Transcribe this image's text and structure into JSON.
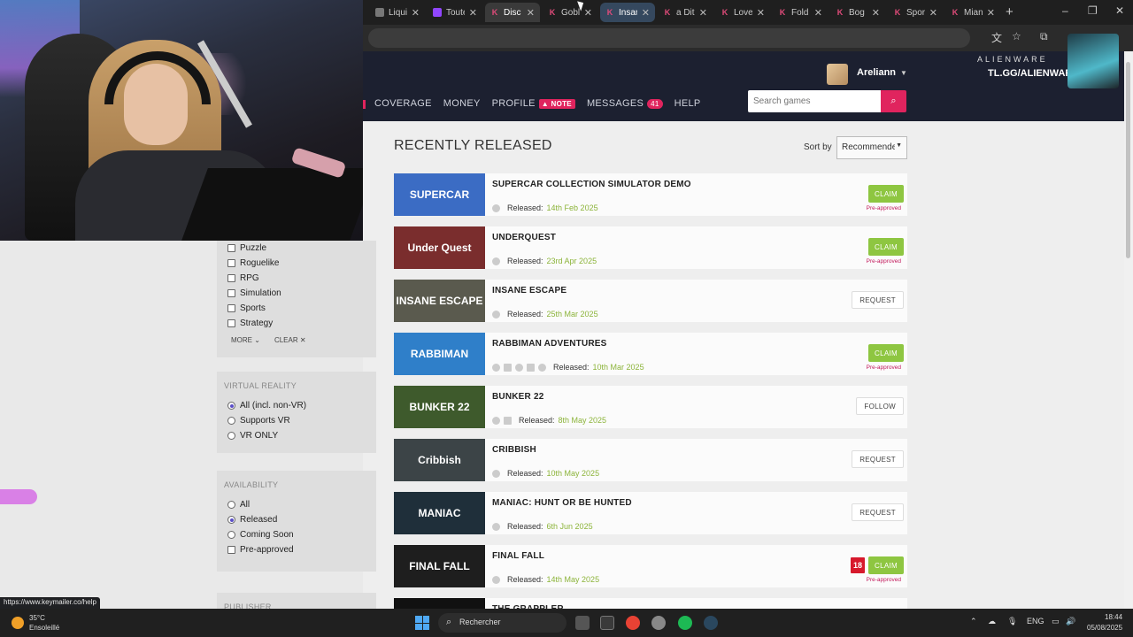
{
  "browser": {
    "tabs": [
      {
        "title": "Liqui",
        "fav": "circle",
        "state": ""
      },
      {
        "title": "Toute",
        "fav": "twitch",
        "state": ""
      },
      {
        "title": "Disc",
        "fav": "k",
        "state": "active"
      },
      {
        "title": "Gobl",
        "fav": "k",
        "state": ""
      },
      {
        "title": "Insan",
        "fav": "k",
        "state": "highlight"
      },
      {
        "title": "a Dit",
        "fav": "k",
        "state": ""
      },
      {
        "title": "Love",
        "fav": "k",
        "state": ""
      },
      {
        "title": "Fold",
        "fav": "k",
        "state": ""
      },
      {
        "title": "Bog",
        "fav": "k",
        "state": ""
      },
      {
        "title": "Spor",
        "fav": "k",
        "state": ""
      },
      {
        "title": "Mian",
        "fav": "k",
        "state": ""
      }
    ],
    "status_url": "https://www.keymailer.co/help"
  },
  "header": {
    "username": "Areliann",
    "nav": {
      "coverage": "COVERAGE",
      "money": "MONEY",
      "profile": "PROFILE",
      "note_badge": "NOTE",
      "messages": "MESSAGES",
      "messages_count": "41",
      "help": "HELP"
    },
    "search_placeholder": "Search games",
    "ad_brand": "ALIENWARE",
    "ad_url": "TL.GG/ALIENWARE"
  },
  "sidebar": {
    "genres": [
      "Puzzle",
      "Roguelike",
      "RPG",
      "Simulation",
      "Sports",
      "Strategy"
    ],
    "more_label": "MORE",
    "clear_label": "CLEAR",
    "vr_title": "VIRTUAL REALITY",
    "vr_options": [
      {
        "label": "All (incl. non-VR)",
        "selected": true
      },
      {
        "label": "Supports VR",
        "selected": false
      },
      {
        "label": "VR ONLY",
        "selected": false
      }
    ],
    "availability_title": "AVAILABILITY",
    "availability_options": [
      {
        "label": "All",
        "type": "radio",
        "selected": false
      },
      {
        "label": "Released",
        "type": "radio",
        "selected": true
      },
      {
        "label": "Coming Soon",
        "type": "radio",
        "selected": false
      },
      {
        "label": "Pre-approved",
        "type": "checkbox",
        "selected": false
      }
    ],
    "publisher_title": "PUBLISHER"
  },
  "main": {
    "title": "RECENTLY RELEASED",
    "sort_label": "Sort by",
    "sort_value": "Recommended",
    "released_label": "Released:",
    "games": [
      {
        "title": "SUPERCAR COLLECTION SIMULATOR DEMO",
        "date": "14th Feb 2025",
        "action": "CLAIM",
        "pre_approved": "Pre-approved",
        "thumb_text": "SUPERCAR",
        "thumb_bg": "#3b6cc4",
        "platforms": 1,
        "pegi": ""
      },
      {
        "title": "UNDERQUEST",
        "date": "23rd Apr 2025",
        "action": "CLAIM",
        "pre_approved": "Pre-approved",
        "thumb_text": "Under Quest",
        "thumb_bg": "#7a2d2d",
        "platforms": 1,
        "pegi": ""
      },
      {
        "title": "INSANE ESCAPE",
        "date": "25th Mar 2025",
        "action": "REQUEST",
        "pre_approved": "",
        "thumb_text": "INSANE ESCAPE",
        "thumb_bg": "#5a5a4e",
        "platforms": 1,
        "pegi": ""
      },
      {
        "title": "RABBIMAN ADVENTURES",
        "date": "10th Mar 2025",
        "action": "CLAIM",
        "pre_approved": "Pre-approved",
        "thumb_text": "RABBIMAN",
        "thumb_bg": "#2f7fc9",
        "platforms": 5,
        "pegi": ""
      },
      {
        "title": "BUNKER 22",
        "date": "8th May 2025",
        "action": "FOLLOW",
        "pre_approved": "",
        "thumb_text": "BUNKER 22",
        "thumb_bg": "#3e5a2c",
        "platforms": 2,
        "pegi": ""
      },
      {
        "title": "CRIBBISH",
        "date": "10th May 2025",
        "action": "REQUEST",
        "pre_approved": "",
        "thumb_text": "Cribbish",
        "thumb_bg": "#3c4447",
        "platforms": 1,
        "pegi": ""
      },
      {
        "title": "MANIAC: HUNT OR BE HUNTED",
        "date": "6th Jun 2025",
        "action": "REQUEST",
        "pre_approved": "",
        "thumb_text": "MANIAC",
        "thumb_bg": "#1f2f3a",
        "platforms": 1,
        "pegi": ""
      },
      {
        "title": "FINAL FALL",
        "date": "14th May 2025",
        "action": "CLAIM",
        "pre_approved": "Pre-approved",
        "thumb_text": "FINAL FALL",
        "thumb_bg": "#1e1e1e",
        "platforms": 1,
        "pegi": "18"
      },
      {
        "title": "THE GRAPPLER",
        "date": "",
        "action": "",
        "pre_approved": "",
        "thumb_text": "THE",
        "thumb_bg": "#111111",
        "platforms": 0,
        "pegi": ""
      }
    ]
  },
  "taskbar": {
    "temp": "35°C",
    "weather": "Ensoleillé",
    "search": "Rechercher",
    "lang": "ENG",
    "time": "18:44",
    "date": "05/08/2025"
  },
  "colors": {
    "accent": "#e0245e",
    "claim": "#8ec641",
    "header_bg": "#1c2030"
  }
}
